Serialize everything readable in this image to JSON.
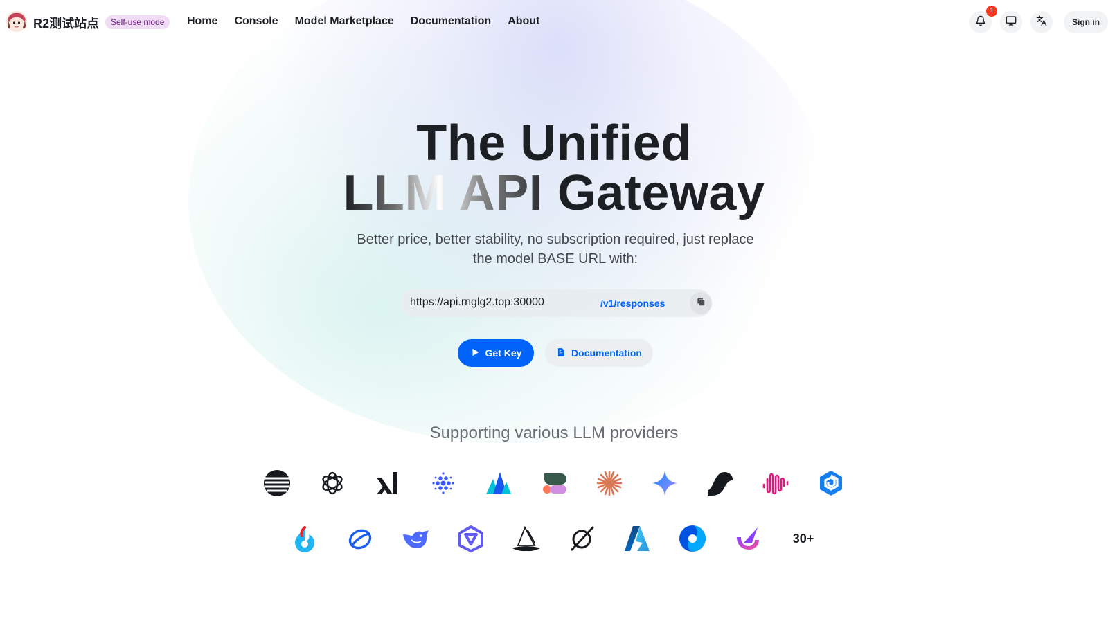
{
  "header": {
    "site_name": "R2测试站点",
    "mode_badge": "Self-use mode",
    "nav": [
      "Home",
      "Console",
      "Model Marketplace",
      "Documentation",
      "About"
    ],
    "notification_count": "1",
    "signin_label": "Sign in",
    "icons": [
      "bell-icon",
      "monitor-icon",
      "translate-icon"
    ]
  },
  "hero": {
    "title_line1": "The Unified",
    "title_line2_shine": "LLM API",
    "title_line2_rest": " Gateway",
    "subtitle": "Better price, better stability, no subscription required, just replace the model BASE URL with:",
    "base_url": "https://api.rnglg2.top:30000",
    "endpoint": "/v1/responses",
    "get_key_label": "Get Key",
    "docs_label": "Documentation"
  },
  "providers": {
    "title": "Supporting various LLM providers",
    "row1": [
      "moonshot-icon",
      "openai-icon",
      "xai-icon",
      "zhipu-icon",
      "volcengine-icon",
      "cohere-icon",
      "claude-icon",
      "gemini-icon",
      "suno-icon",
      "minimax-icon",
      "wenxin-icon"
    ],
    "row2": [
      "spark-icon",
      "doubao-icon",
      "deepseek-icon",
      "qwen-icon",
      "midjourney-icon",
      "grok-icon",
      "azure-icon",
      "hunyuan-icon",
      "kling-icon"
    ],
    "more_label": "30+"
  },
  "colors": {
    "accent": "#0064fa",
    "badge_bg": "#f1dcf5",
    "badge_text": "#6b2283",
    "notif": "#f93920"
  }
}
